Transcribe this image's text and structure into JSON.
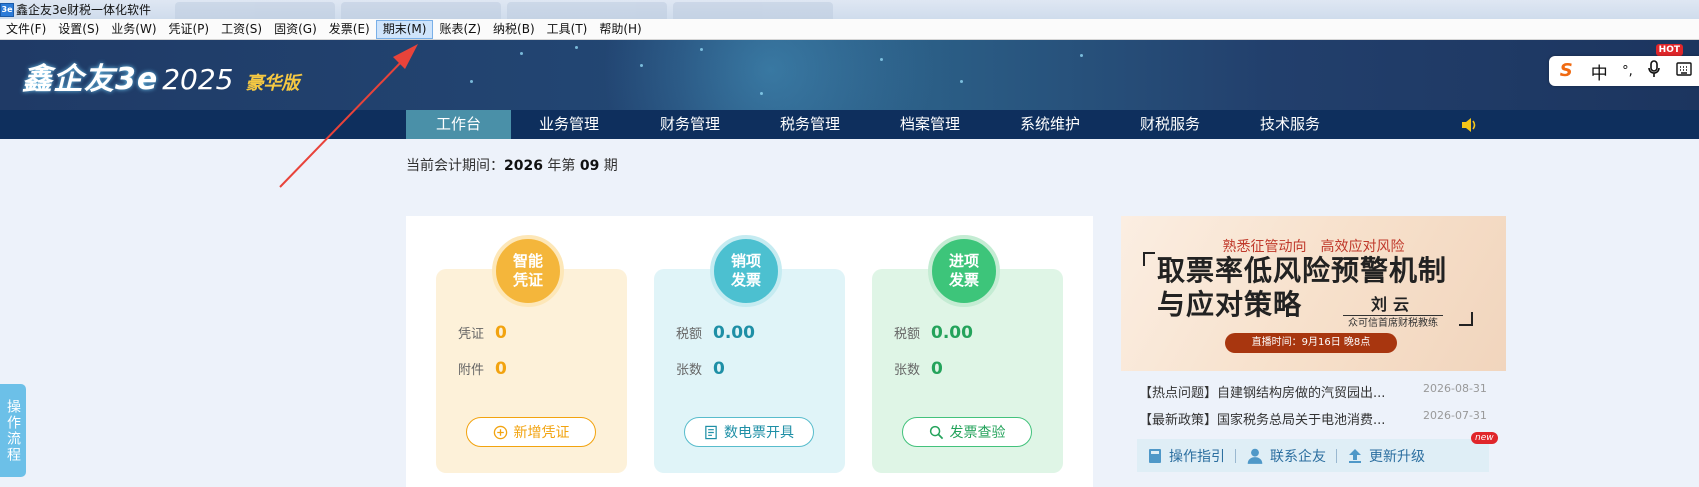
{
  "window": {
    "app_icon": "3e",
    "title": "鑫企友3e财税一体化软件"
  },
  "menu": [
    "文件(F)",
    "设置(S)",
    "业务(W)",
    "凭证(P)",
    "工资(S)",
    "固资(G)",
    "发票(E)",
    "期末(M)",
    "账表(Z)",
    "纳税(B)",
    "工具(T)",
    "帮助(H)"
  ],
  "menu_active": "期末(M)",
  "banner": {
    "logo_name": "鑫企友3e",
    "logo_year": "2025",
    "logo_edition": "豪华版"
  },
  "ime": {
    "s": "S",
    "lang": "中",
    "punct": "°,",
    "hot": "HOT"
  },
  "nav": [
    "工作台",
    "业务管理",
    "财务管理",
    "税务管理",
    "档案管理",
    "系统维护",
    "财税服务",
    "技术服务"
  ],
  "period": {
    "prefix": "当前会计期间：",
    "year": "2026",
    "year_suffix": " 年第 ",
    "period": "09",
    "period_suffix": " 期"
  },
  "cards": [
    {
      "badge": "智能凭证",
      "row1_label": "凭证",
      "row1_value": "0",
      "row2_label": "附件",
      "row2_value": "0",
      "button": "新增凭证"
    },
    {
      "badge": "销项发票",
      "row1_label": "税额",
      "row1_value": "0.00",
      "row2_label": "张数",
      "row2_value": "0",
      "button": "数电票开具"
    },
    {
      "badge": "进项发票",
      "row1_label": "税额",
      "row1_value": "0.00",
      "row2_label": "张数",
      "row2_value": "0",
      "button": "发票查验"
    }
  ],
  "promo": {
    "subtitle": "熟悉征管动向　高效应对风险",
    "title_line1": "取票率低风险预警机制",
    "title_line2": "与应对策略",
    "speaker": "刘云",
    "speaker_role": "众可信首席财税教练",
    "time": "直播时间：9月16日 晚8点"
  },
  "news": [
    {
      "title": "【热点问题】自建钢结构房做的汽贸园出...",
      "date": "2026-08-31"
    },
    {
      "title": "【最新政策】国家税务总局关于电池消费...",
      "date": "2026-07-31"
    }
  ],
  "quick_links": [
    "操作指引",
    "联系企友",
    "更新升级"
  ],
  "new_badge": "new",
  "side_tab": "操作流程",
  "colors": {
    "nav_bg": "#0e2f5d",
    "nav_active": "#4a90a8",
    "annotation_arrow": "#e8433a"
  }
}
